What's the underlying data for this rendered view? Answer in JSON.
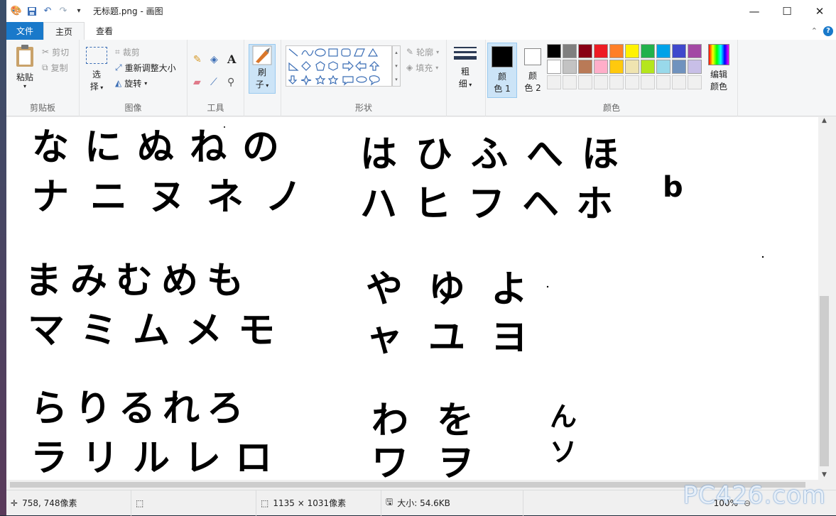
{
  "window": {
    "title": "无标题.png - 画图",
    "controls": [
      "—",
      "☐",
      "✕"
    ]
  },
  "tabs": {
    "file": "文件",
    "home": "主页",
    "view": "查看"
  },
  "ribbon": {
    "clipboard": {
      "label": "剪贴板",
      "paste": "粘贴",
      "cut": "剪切",
      "copy": "复制"
    },
    "image": {
      "label": "图像",
      "select_top": "选",
      "select_bottom": "择",
      "crop": "裁剪",
      "resize": "重新调整大小",
      "rotate": "旋转"
    },
    "tools": {
      "label": "工具"
    },
    "brushes": {
      "top": "刷",
      "bottom": "子"
    },
    "shapes": {
      "label": "形状",
      "outline": "轮廓",
      "fill": "填充"
    },
    "size": {
      "top": "粗",
      "bottom": "细"
    },
    "colors": {
      "label": "颜色",
      "color1_top": "颜",
      "color1_bottom": "色 1",
      "color2_top": "颜",
      "color2_bottom": "色 2",
      "edit_top": "编辑",
      "edit_bottom": "颜色",
      "color1_value": "#000000",
      "color2_value": "#ffffff",
      "palette_row1": [
        "#000000",
        "#7f7f7f",
        "#880015",
        "#ed1c24",
        "#ff7f27",
        "#fff200",
        "#22b14c",
        "#00a2e8",
        "#3f48cc",
        "#a349a4"
      ],
      "palette_row2": [
        "#ffffff",
        "#c3c3c3",
        "#b97a57",
        "#ffaec9",
        "#ffc90e",
        "#efe4b0",
        "#b5e61d",
        "#99d9ea",
        "#7092be",
        "#c8bfe7"
      ],
      "palette_row3": [
        "#f0f0f0",
        "#f0f0f0",
        "#f0f0f0",
        "#f0f0f0",
        "#f0f0f0",
        "#f0f0f0",
        "#f0f0f0",
        "#f0f0f0",
        "#f0f0f0",
        "#f0f0f0"
      ]
    }
  },
  "canvas": {
    "rows": [
      {
        "hira": [
          "な",
          "に",
          "ぬ",
          "ね",
          "の"
        ],
        "kata": [
          "ナ",
          "ニ",
          "ヌ",
          "ネ",
          "ノ"
        ]
      },
      {
        "hira": [
          "は",
          "ひ",
          "ふ",
          "へ",
          "ほ"
        ],
        "kata": [
          "ハ",
          "ヒ",
          "フ",
          "ヘ",
          "ホ"
        ]
      },
      {
        "hira": [
          "ま",
          "み",
          "む",
          "め",
          "も"
        ],
        "kata": [
          "マ",
          "ミ",
          "ム",
          "メ",
          "モ"
        ]
      },
      {
        "hira": [
          "や",
          "ゆ",
          "よ"
        ],
        "kata": [
          "ャ",
          "ユ",
          "ヨ"
        ]
      },
      {
        "hira": [
          "ら",
          "り",
          "る",
          "れ",
          "ろ"
        ],
        "kata": [
          "ラ",
          "リ",
          "ル",
          "レ",
          "ロ"
        ]
      },
      {
        "hira": [
          "わ",
          "を"
        ],
        "kata": [
          "ワ",
          "ヲ"
        ]
      },
      {
        "hira": [
          "ん"
        ],
        "kata": [
          "ソ"
        ]
      }
    ],
    "extra_mark": "b"
  },
  "status": {
    "cursor": "758, 748像素",
    "dimensions": "1135 × 1031像素",
    "size": "大小: 54.6KB",
    "zoom": "100%"
  },
  "watermark": "PC426.com"
}
